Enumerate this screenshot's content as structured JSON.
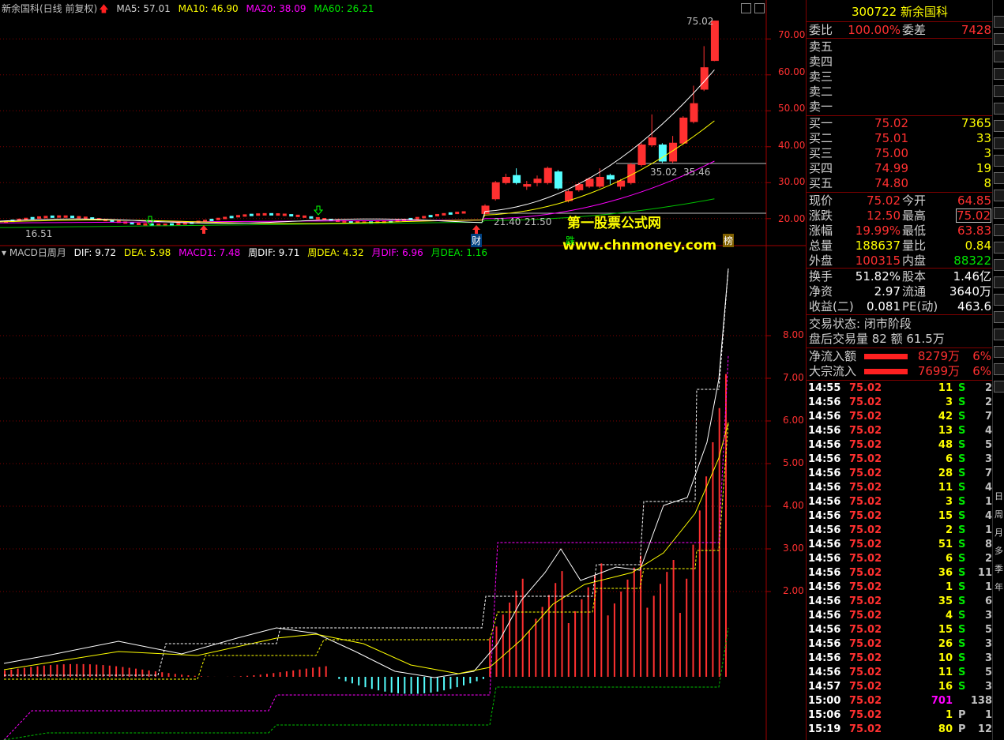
{
  "kline_header": {
    "title": "新余国科(日线 前复权)",
    "ma5": "MA5: 57.01",
    "ma10": "MA10: 46.90",
    "ma20": "MA20: 38.09",
    "ma60": "MA60: 26.21"
  },
  "macd_header": {
    "title": "MACD日周月",
    "dif": "DIF: 9.72",
    "dea": "DEA: 5.98",
    "macd1": "MACD1: 7.48",
    "wdif": "周DIF: 9.71",
    "wdea": "周DEA: 4.32",
    "mdif": "月DIF: 6.96",
    "mdea": "月DEA: 1.16"
  },
  "kline_axis": [
    "70.00",
    "60.00",
    "50.00",
    "40.00",
    "30.00",
    "20.00"
  ],
  "macd_axis": [
    "8.00",
    "7.00",
    "6.00",
    "5.00",
    "4.00",
    "3.00",
    "2.00"
  ],
  "annotations": {
    "high": "75.02",
    "mid1": "35.02",
    "mid2": "35.46",
    "low1": "21.40",
    "low2": "21.50",
    "start": "16.51",
    "tag_cai": "财",
    "tag_die": "跌",
    "tag_bang": "榜"
  },
  "watermark": {
    "line1": "第一股票公式网",
    "line2": "www.chnmoney.com"
  },
  "chart_data": {
    "type": "candlestick",
    "title": "新余国科(日线 前复权)",
    "ylim": [
      16,
      76
    ],
    "candles_recent": [
      {
        "o": 21.4,
        "c": 23.5,
        "h": 24.0,
        "l": 21.2
      },
      {
        "o": 25.5,
        "c": 30.0,
        "h": 30.5,
        "l": 25.0
      },
      {
        "o": 30.0,
        "c": 31.5,
        "h": 32.5,
        "l": 29.5
      },
      {
        "o": 32.0,
        "c": 30.0,
        "h": 34.0,
        "l": 29.5
      },
      {
        "o": 29.0,
        "c": 29.5,
        "h": 30.5,
        "l": 28.0
      },
      {
        "o": 30.0,
        "c": 31.0,
        "h": 32.0,
        "l": 29.0
      },
      {
        "o": 30.0,
        "c": 34.0,
        "h": 34.5,
        "l": 29.5
      },
      {
        "o": 33.0,
        "c": 28.5,
        "h": 33.5,
        "l": 28.0
      },
      {
        "o": 25.0,
        "c": 27.5,
        "h": 28.0,
        "l": 24.5
      },
      {
        "o": 28.0,
        "c": 29.5,
        "h": 30.0,
        "l": 27.5
      },
      {
        "o": 29.0,
        "c": 31.0,
        "h": 31.5,
        "l": 28.5
      },
      {
        "o": 29.0,
        "c": 31.5,
        "h": 34.0,
        "l": 28.5
      },
      {
        "o": 32.0,
        "c": 31.0,
        "h": 32.5,
        "l": 29.5
      },
      {
        "o": 29.0,
        "c": 30.5,
        "h": 31.0,
        "l": 28.0
      },
      {
        "o": 30.0,
        "c": 35.0,
        "h": 35.5,
        "l": 29.5
      },
      {
        "o": 35.0,
        "c": 40.5,
        "h": 41.0,
        "l": 34.5
      },
      {
        "o": 40.5,
        "c": 42.5,
        "h": 49.0,
        "l": 40.0
      },
      {
        "o": 40.5,
        "c": 36.0,
        "h": 41.0,
        "l": 35.5
      },
      {
        "o": 36.0,
        "c": 41.0,
        "h": 43.0,
        "l": 35.5
      },
      {
        "o": 41.0,
        "c": 48.0,
        "h": 48.5,
        "l": 40.5
      },
      {
        "o": 47.0,
        "c": 52.0,
        "h": 57.0,
        "l": 46.5
      },
      {
        "o": 56.0,
        "c": 62.0,
        "h": 68.0,
        "l": 55.5
      },
      {
        "o": 64.0,
        "c": 75.0,
        "h": 75.0,
        "l": 63.8
      }
    ]
  },
  "quote": {
    "code": "300722",
    "name": "新余国科",
    "weibi_label": "委比",
    "weibi": "100.00%",
    "weicha_label": "委差",
    "weicha": "7428",
    "asks": [
      {
        "label": "卖五"
      },
      {
        "label": "卖四"
      },
      {
        "label": "卖三"
      },
      {
        "label": "卖二"
      },
      {
        "label": "卖一"
      }
    ],
    "bids": [
      {
        "label": "买一",
        "price": "75.02",
        "vol": "7365"
      },
      {
        "label": "买二",
        "price": "75.01",
        "vol": "33"
      },
      {
        "label": "买三",
        "price": "75.00",
        "vol": "3"
      },
      {
        "label": "买四",
        "price": "74.99",
        "vol": "19"
      },
      {
        "label": "买五",
        "price": "74.80",
        "vol": "8"
      }
    ],
    "stats": [
      {
        "l1": "现价",
        "v1": "75.02",
        "l2": "今开",
        "v2": "64.85"
      },
      {
        "l1": "涨跌",
        "v1": "12.50",
        "l2": "最高",
        "v2": "75.02"
      },
      {
        "l1": "涨幅",
        "v1": "19.99%",
        "l2": "最低",
        "v2": "63.83"
      },
      {
        "l1": "总量",
        "v1": "188637",
        "l2": "量比",
        "v2": "0.84"
      },
      {
        "l1": "外盘",
        "v1": "100315",
        "l2": "内盘",
        "v2": "88322"
      }
    ],
    "stats2": [
      {
        "l1": "换手",
        "v1": "51.82%",
        "l2": "股本",
        "v2": "1.46亿"
      },
      {
        "l1": "净资",
        "v1": "2.97",
        "l2": "流通",
        "v2": "3640万"
      },
      {
        "l1": "收益(二)",
        "v1": "0.081",
        "l2": "PE(动)",
        "v2": "463.6"
      }
    ],
    "status_line": "交易状态: 闭市阶段",
    "after_line": "盘后交易量 82 额 61.5万",
    "flow": [
      {
        "label": "净流入额",
        "value": "8279万",
        "pct": "6%"
      },
      {
        "label": "大宗流入",
        "value": "7699万",
        "pct": "6%"
      }
    ]
  },
  "ticks": [
    {
      "time": "14:55",
      "price": "75.02",
      "vol": "11",
      "bs": "S",
      "n": "2"
    },
    {
      "time": "14:56",
      "price": "75.02",
      "vol": "3",
      "bs": "S",
      "n": "2"
    },
    {
      "time": "14:56",
      "price": "75.02",
      "vol": "42",
      "bs": "S",
      "n": "7"
    },
    {
      "time": "14:56",
      "price": "75.02",
      "vol": "13",
      "bs": "S",
      "n": "4"
    },
    {
      "time": "14:56",
      "price": "75.02",
      "vol": "48",
      "bs": "S",
      "n": "5"
    },
    {
      "time": "14:56",
      "price": "75.02",
      "vol": "6",
      "bs": "S",
      "n": "3"
    },
    {
      "time": "14:56",
      "price": "75.02",
      "vol": "28",
      "bs": "S",
      "n": "7"
    },
    {
      "time": "14:56",
      "price": "75.02",
      "vol": "11",
      "bs": "S",
      "n": "4"
    },
    {
      "time": "14:56",
      "price": "75.02",
      "vol": "3",
      "bs": "S",
      "n": "1"
    },
    {
      "time": "14:56",
      "price": "75.02",
      "vol": "15",
      "bs": "S",
      "n": "4"
    },
    {
      "time": "14:56",
      "price": "75.02",
      "vol": "2",
      "bs": "S",
      "n": "1"
    },
    {
      "time": "14:56",
      "price": "75.02",
      "vol": "51",
      "bs": "S",
      "n": "8"
    },
    {
      "time": "14:56",
      "price": "75.02",
      "vol": "6",
      "bs": "S",
      "n": "2"
    },
    {
      "time": "14:56",
      "price": "75.02",
      "vol": "36",
      "bs": "S",
      "n": "11"
    },
    {
      "time": "14:56",
      "price": "75.02",
      "vol": "1",
      "bs": "S",
      "n": "1"
    },
    {
      "time": "14:56",
      "price": "75.02",
      "vol": "35",
      "bs": "S",
      "n": "6"
    },
    {
      "time": "14:56",
      "price": "75.02",
      "vol": "4",
      "bs": "S",
      "n": "3"
    },
    {
      "time": "14:56",
      "price": "75.02",
      "vol": "15",
      "bs": "S",
      "n": "5"
    },
    {
      "time": "14:56",
      "price": "75.02",
      "vol": "26",
      "bs": "S",
      "n": "3"
    },
    {
      "time": "14:56",
      "price": "75.02",
      "vol": "10",
      "bs": "S",
      "n": "3"
    },
    {
      "time": "14:56",
      "price": "75.02",
      "vol": "11",
      "bs": "S",
      "n": "5"
    },
    {
      "time": "14:57",
      "price": "75.02",
      "vol": "16",
      "bs": "S",
      "n": "3"
    },
    {
      "time": "15:00",
      "price": "75.02",
      "vol": "701",
      "bs": "",
      "n": "138"
    },
    {
      "time": "15:06",
      "price": "75.02",
      "vol": "1",
      "bs": "P",
      "n": "1"
    },
    {
      "time": "15:19",
      "price": "75.02",
      "vol": "80",
      "bs": "P",
      "n": "12"
    }
  ],
  "toolbar_labels": [
    "日",
    "周",
    "月",
    "多",
    "季",
    "年"
  ]
}
